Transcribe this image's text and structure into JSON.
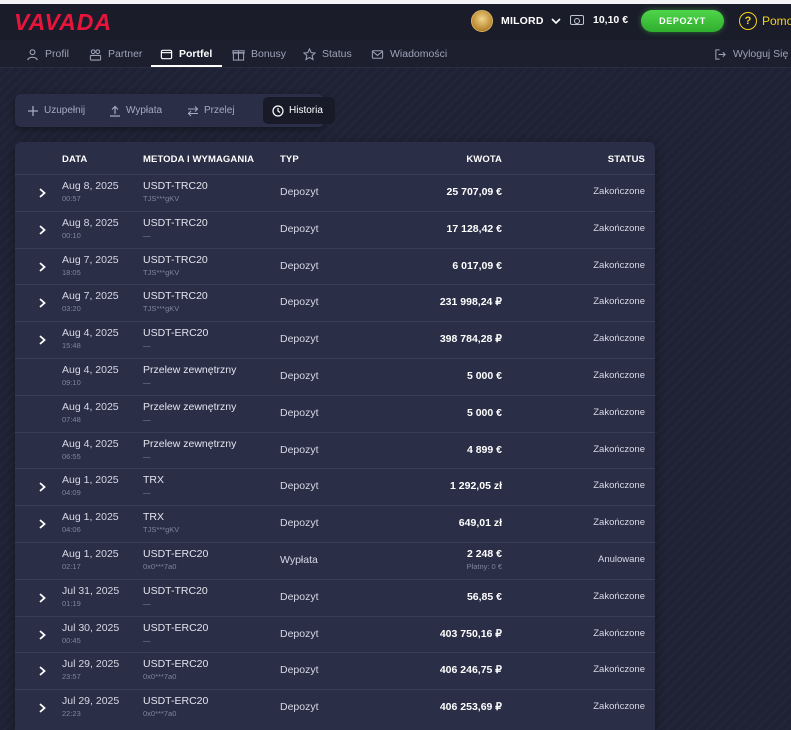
{
  "brand": {
    "logo_text": "VAVADA",
    "logo_color": "#e8143c"
  },
  "header": {
    "username": "MILORD",
    "balance": "10,10 €",
    "deposit_label": "DEPOZYT",
    "help_label": "Pomo",
    "accent_green": "#3bc437",
    "help_color": "#f2d21b"
  },
  "nav": {
    "items": [
      {
        "label": "Profil",
        "icon": "user-icon"
      },
      {
        "label": "Partner",
        "icon": "partner-icon"
      },
      {
        "label": "Portfel",
        "icon": "wallet-icon",
        "active": true
      },
      {
        "label": "Bonusy",
        "icon": "gift-icon"
      },
      {
        "label": "Status",
        "icon": "star-icon"
      },
      {
        "label": "Wiadomości",
        "icon": "mail-icon"
      }
    ],
    "logout_label": "Wyloguj Się"
  },
  "subtabs": {
    "items": [
      {
        "label": "Uzupełnij",
        "icon": "plus-icon"
      },
      {
        "label": "Wypłata",
        "icon": "upload-icon"
      },
      {
        "label": "Przelej",
        "icon": "transfer-icon"
      },
      {
        "label": "Historia",
        "icon": "clock-icon",
        "active": true
      }
    ]
  },
  "table": {
    "columns": [
      "DATA",
      "METODA I WYMAGANIA",
      "TYP",
      "KWOTA",
      "STATUS"
    ],
    "rows": [
      {
        "expandable": true,
        "date": "Aug 8, 2025",
        "time": "00:57",
        "method": "USDT-TRC20",
        "sub": "TJS***gKV",
        "type": "Depozyt",
        "amount": "25 707,09 €",
        "status": "Zakończone"
      },
      {
        "expandable": true,
        "date": "Aug 8, 2025",
        "time": "00:10",
        "method": "USDT-TRC20",
        "sub": "—",
        "type": "Depozyt",
        "amount": "17 128,42 €",
        "status": "Zakończone"
      },
      {
        "expandable": true,
        "date": "Aug 7, 2025",
        "time": "18:05",
        "method": "USDT-TRC20",
        "sub": "TJS***gKV",
        "type": "Depozyt",
        "amount": "6 017,09 €",
        "status": "Zakończone"
      },
      {
        "expandable": true,
        "date": "Aug 7, 2025",
        "time": "03:20",
        "method": "USDT-TRC20",
        "sub": "TJS***gKV",
        "type": "Depozyt",
        "amount": "231 998,24 ₽",
        "status": "Zakończone"
      },
      {
        "expandable": true,
        "date": "Aug 4, 2025",
        "time": "15:48",
        "method": "USDT-ERC20",
        "sub": "—",
        "type": "Depozyt",
        "amount": "398 784,28 ₽",
        "status": "Zakończone"
      },
      {
        "expandable": false,
        "date": "Aug 4, 2025",
        "time": "09:10",
        "method": "Przelew zewnętrzny",
        "sub": "—",
        "type": "Depozyt",
        "amount": "5 000 €",
        "status": "Zakończone"
      },
      {
        "expandable": false,
        "date": "Aug 4, 2025",
        "time": "07:48",
        "method": "Przelew zewnętrzny",
        "sub": "—",
        "type": "Depozyt",
        "amount": "5 000 €",
        "status": "Zakończone"
      },
      {
        "expandable": false,
        "date": "Aug 4, 2025",
        "time": "06:55",
        "method": "Przelew zewnętrzny",
        "sub": "—",
        "type": "Depozyt",
        "amount": "4 899 €",
        "status": "Zakończone"
      },
      {
        "expandable": true,
        "date": "Aug 1, 2025",
        "time": "04:09",
        "method": "TRX",
        "sub": "—",
        "type": "Depozyt",
        "amount": "1 292,05 zł",
        "status": "Zakończone"
      },
      {
        "expandable": true,
        "date": "Aug 1, 2025",
        "time": "04:06",
        "method": "TRX",
        "sub": "TJS***gKV",
        "type": "Depozyt",
        "amount": "649,01 zł",
        "status": "Zakończone"
      },
      {
        "expandable": false,
        "date": "Aug 1, 2025",
        "time": "02:17",
        "method": "USDT-ERC20",
        "sub": "0x0***7a0",
        "type": "Wypłata",
        "amount": "2 248 €",
        "paid": "Płatny: 0 €",
        "status": "Anulowane"
      },
      {
        "expandable": true,
        "date": "Jul 31, 2025",
        "time": "01:19",
        "method": "USDT-TRC20",
        "sub": "—",
        "type": "Depozyt",
        "amount": "56,85 €",
        "status": "Zakończone"
      },
      {
        "expandable": true,
        "date": "Jul 30, 2025",
        "time": "00:45",
        "method": "USDT-ERC20",
        "sub": "—",
        "type": "Depozyt",
        "amount": "403 750,16 ₽",
        "status": "Zakończone"
      },
      {
        "expandable": true,
        "date": "Jul 29, 2025",
        "time": "23:57",
        "method": "USDT-ERC20",
        "sub": "0x0***7a0",
        "type": "Depozyt",
        "amount": "406 246,75 ₽",
        "status": "Zakończone"
      },
      {
        "expandable": true,
        "date": "Jul 29, 2025",
        "time": "22:23",
        "method": "USDT-ERC20",
        "sub": "0x0***7a0",
        "type": "Depozyt",
        "amount": "406 253,69 ₽",
        "status": "Zakończone"
      }
    ]
  }
}
